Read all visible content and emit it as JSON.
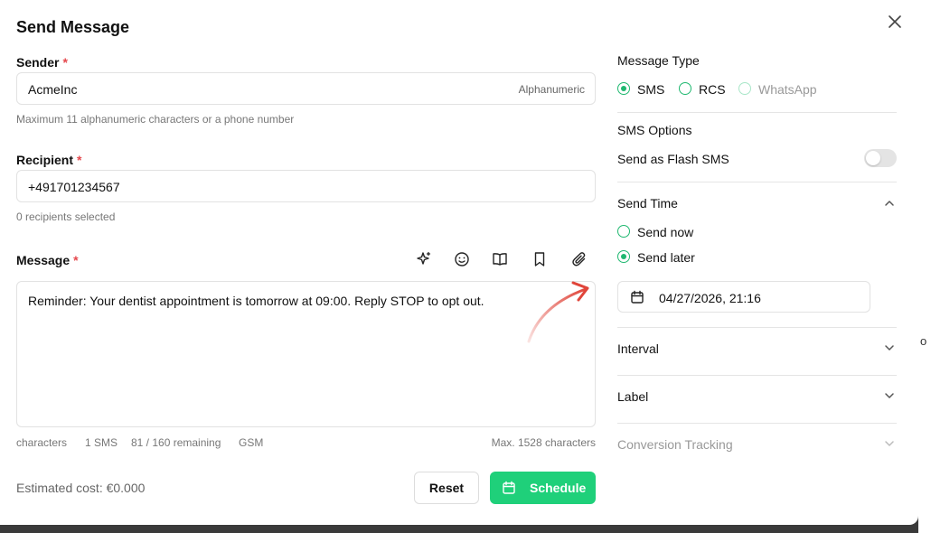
{
  "dialog": {
    "title": "Send Message",
    "close_icon": "close-icon"
  },
  "sender": {
    "label": "Sender",
    "required_mark": "*",
    "value": "AcmeInc",
    "type_hint": "Alphanumeric",
    "help": "Maximum 11 alphanumeric characters or a phone number"
  },
  "recipient": {
    "label": "Recipient",
    "required_mark": "*",
    "value": "+491701234567",
    "help": "0 recipients selected"
  },
  "message": {
    "label": "Message",
    "required_mark": "*",
    "toolbar_icons": [
      "sparkles-icon",
      "emoji-icon",
      "book-icon",
      "bookmark-icon",
      "paperclip-icon"
    ],
    "text": "Reminder: Your dentist appointment is tomorrow at 09:00. Reply STOP to opt out.",
    "stats": {
      "characters": "characters",
      "sms_count": "1 SMS",
      "remaining": "81 / 160 remaining",
      "encoding": "GSM",
      "max": "Max. 1528 characters"
    }
  },
  "footer": {
    "cost": "Estimated cost: €0.000",
    "reset_label": "Reset",
    "schedule_label": "Schedule"
  },
  "message_type": {
    "label": "Message Type",
    "options": [
      {
        "label": "SMS",
        "selected": true,
        "disabled": false
      },
      {
        "label": "RCS",
        "selected": false,
        "disabled": false
      },
      {
        "label": "WhatsApp",
        "selected": false,
        "disabled": true
      }
    ]
  },
  "sms_options": {
    "label": "SMS Options",
    "flash_label": "Send as Flash SMS",
    "flash_enabled": false
  },
  "send_time": {
    "label": "Send Time",
    "options": [
      {
        "label": "Send now",
        "selected": false
      },
      {
        "label": "Send later",
        "selected": true
      }
    ],
    "datetime": "04/27/2026, 21:16"
  },
  "sections": {
    "interval": "Interval",
    "label": "Label",
    "conversion": "Conversion Tracking"
  },
  "colors": {
    "accent": "#1fd07a",
    "required": "#e5484d",
    "annotation_arrow": "#e0453a"
  }
}
